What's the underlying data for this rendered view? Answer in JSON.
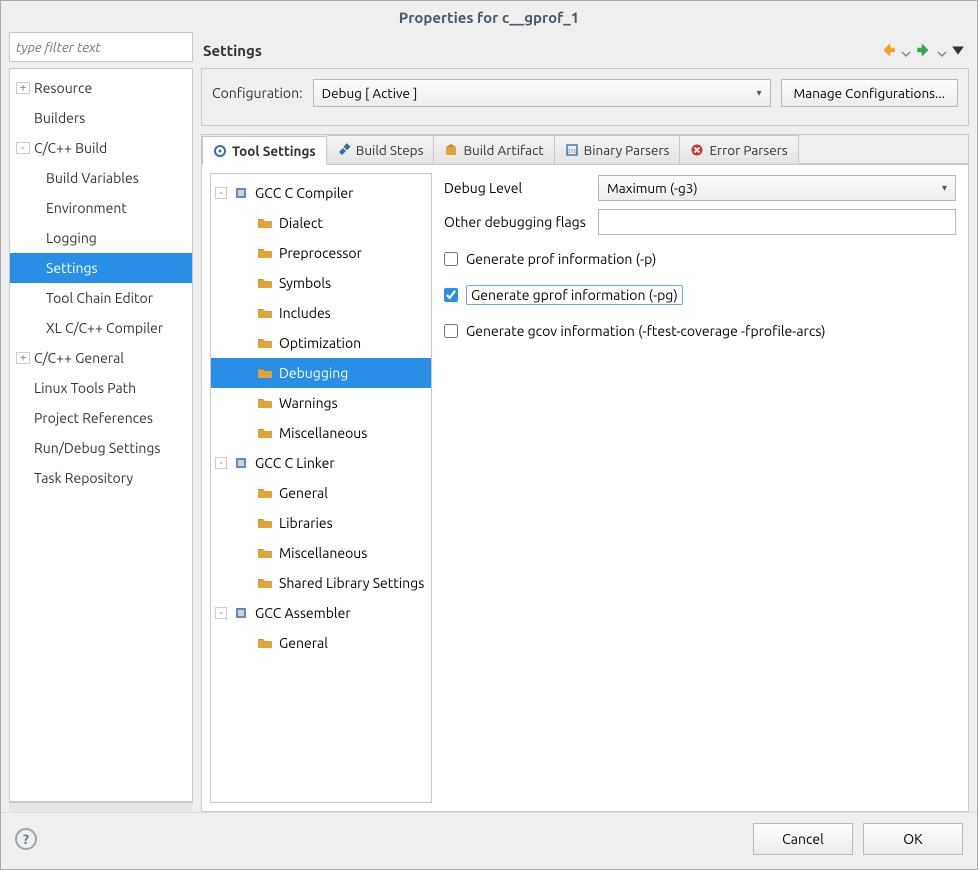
{
  "window_title": "Properties for c__gprof_1",
  "filter_placeholder": "type filter text",
  "heading": "Settings",
  "nav": {
    "items": [
      {
        "label": "Resource",
        "exp": "+",
        "children": []
      },
      {
        "label": "Builders",
        "exp": "",
        "children": []
      },
      {
        "label": "C/C++ Build",
        "exp": "-",
        "children": [
          "Build Variables",
          "Environment",
          "Logging",
          "Settings",
          "Tool Chain Editor",
          "XL C/C++ Compiler"
        ],
        "selected_child": 3
      },
      {
        "label": "C/C++ General",
        "exp": "+",
        "children": []
      },
      {
        "label": "Linux Tools Path",
        "exp": "",
        "children": []
      },
      {
        "label": "Project References",
        "exp": "",
        "children": []
      },
      {
        "label": "Run/Debug Settings",
        "exp": "",
        "children": []
      },
      {
        "label": "Task Repository",
        "exp": "",
        "children": []
      }
    ]
  },
  "config": {
    "label": "Configuration:",
    "value": "Debug  [ Active ]",
    "manage": "Manage Configurations..."
  },
  "tabs": [
    "Tool Settings",
    "Build Steps",
    "Build Artifact",
    "Binary Parsers",
    "Error Parsers"
  ],
  "active_tab": 0,
  "tool_tree": [
    {
      "label": "GCC C Compiler",
      "type": "tool",
      "exp": "-",
      "children": [
        "Dialect",
        "Preprocessor",
        "Symbols",
        "Includes",
        "Optimization",
        "Debugging",
        "Warnings",
        "Miscellaneous"
      ],
      "selected_child": 5
    },
    {
      "label": "GCC C Linker",
      "type": "tool",
      "exp": "-",
      "children": [
        "General",
        "Libraries",
        "Miscellaneous",
        "Shared Library Settings"
      ]
    },
    {
      "label": "GCC Assembler",
      "type": "tool",
      "exp": "-",
      "children": [
        "General"
      ]
    }
  ],
  "settings": {
    "debug_level_label": "Debug Level",
    "debug_level_value": "Maximum (-g3)",
    "other_flags_label": "Other debugging flags",
    "other_flags_value": "",
    "chk_prof": {
      "label": "Generate prof information (-p)",
      "checked": false
    },
    "chk_gprof": {
      "label": "Generate gprof information (-pg)",
      "checked": true,
      "highlight": true
    },
    "chk_gcov": {
      "label": "Generate gcov information (-ftest-coverage -fprofile-arcs)",
      "checked": false
    }
  },
  "buttons": {
    "cancel": "Cancel",
    "ok": "OK"
  }
}
